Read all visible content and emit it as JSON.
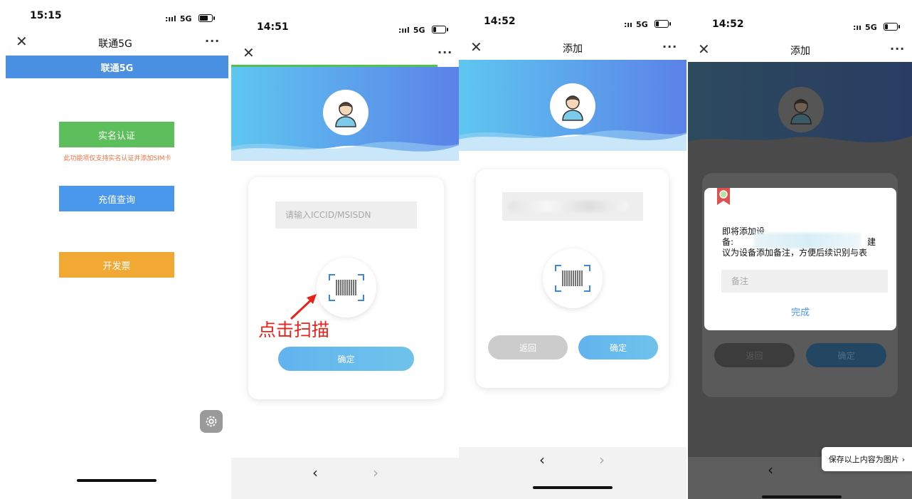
{
  "screen1": {
    "time": "15:15",
    "network": "5G",
    "nav_title": "联通5G",
    "header_title": "联通5G",
    "btn_realname": "实名认证",
    "realname_note": "此功能项仅支持实名认证并添加SIM卡",
    "btn_recharge": "充值查询",
    "btn_invoice": "开发票",
    "colors": {
      "header": "#4a90e2",
      "green": "#5cbf5c",
      "blue": "#4a98ee",
      "orange": "#f2a933",
      "note": "#f07040"
    }
  },
  "screen2": {
    "time": "14:51",
    "network": "5G",
    "input_placeholder": "请输入ICCID/MSISDN",
    "annotation": "点击扫描",
    "btn_confirm": "确定",
    "colors": {
      "annotation": "#e8231c"
    }
  },
  "screen3": {
    "time": "14:52",
    "network": "5G",
    "nav_title": "添加",
    "btn_back": "返回",
    "btn_confirm": "确定"
  },
  "screen4": {
    "time": "14:52",
    "network": "5G",
    "nav_title": "添加",
    "dialog_line1": "即将添加设",
    "dialog_line2_prefix": "备:",
    "dialog_line2_suffix": "建",
    "dialog_line3": "议为设备添加备注，方便后续识别与表",
    "remark_placeholder": "备注",
    "done_label": "完成",
    "btn_back": "返回",
    "btn_confirm": "确定",
    "save_toast": "保存以上内容为图片",
    "save_toast_arrow": "›"
  },
  "icons": {
    "close": "✕",
    "more": "···",
    "back": "‹",
    "forward": "›",
    "settings": "gear-icon",
    "scan": "barcode-scan-icon",
    "avatar": "user-avatar-icon",
    "badge": "badge-icon"
  }
}
